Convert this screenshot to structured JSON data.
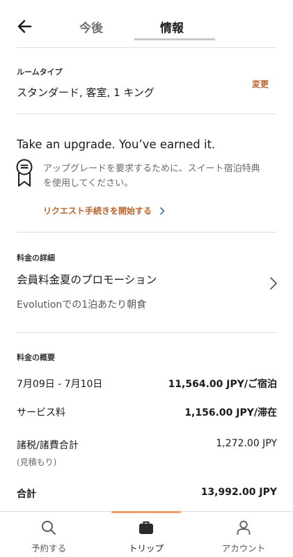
{
  "header": {
    "tabs": [
      {
        "label": "今後"
      },
      {
        "label": "情報"
      }
    ]
  },
  "room_type": {
    "section_label": "ルームタイプ",
    "value": "スタンダード, 客室, 1 キング",
    "change_label": "変更"
  },
  "upgrade": {
    "title": "Take an upgrade. You’ve earned it.",
    "description": "アップグレードを要求するために、スイート宿泊特典を使用してください。",
    "request_link": "リクエスト手続きを開始する",
    "icon": "medal-icon"
  },
  "rate_details": {
    "section_label": "料金の詳細",
    "name": "会員料金夏のプロモーション",
    "subtitle": "Evolutionでの1泊あたり朝食"
  },
  "rate_summary": {
    "section_label": "料金の概要",
    "rows": [
      {
        "left": "7月09日 - 7月10日",
        "right": "11,564.00 JPY/ご宿泊"
      },
      {
        "left": "サービス料",
        "right": "1,156.00 JPY/滞在"
      },
      {
        "left": "諸税/諸費合計",
        "left_sub": "(見積もり)",
        "right": "1,272.00 JPY"
      },
      {
        "left": "合計",
        "right": "13,992.00 JPY"
      }
    ]
  },
  "tabbar": {
    "items": [
      {
        "label": "予約する",
        "icon": "search-icon"
      },
      {
        "label": "トリップ",
        "icon": "suitcase-icon"
      },
      {
        "label": "アカウント",
        "icon": "person-icon"
      }
    ],
    "active_index": 1
  },
  "colors": {
    "accent": "#b8652b",
    "indicator": "#f29d63"
  }
}
